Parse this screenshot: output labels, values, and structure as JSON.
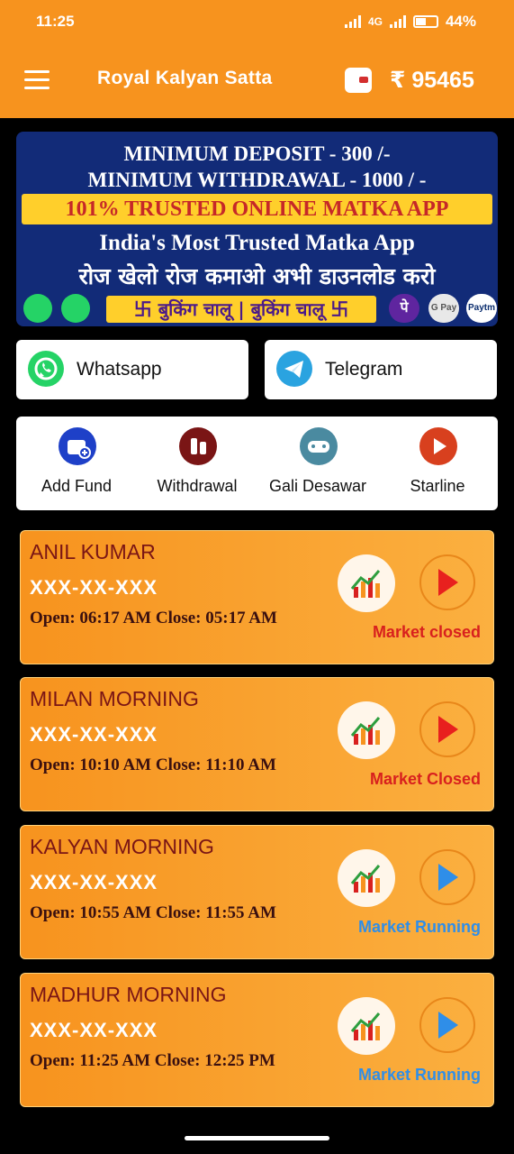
{
  "status_bar": {
    "time": "11:25",
    "network": "4G",
    "battery": "44%"
  },
  "header": {
    "title": "Royal Kalyan Satta",
    "balance": "₹ 95465"
  },
  "banner": {
    "line1": "MINIMUM DEPOSIT - 300 /-",
    "line2": "MINIMUM WITHDRAWAL - 1000 / -",
    "line3": "101% TRUSTED ONLINE MATKA APP",
    "line4": "India's Most Trusted Matka App",
    "line5": "रोज खेलो रोज कमाओ अभी डाउनलोड करो",
    "booking": "卐 बुकिंग चालू | बुकिंग चालू 卐",
    "chip_phonepe": "पे",
    "chip_gpay": "G Pay",
    "chip_paytm": "Paytm"
  },
  "contact_buttons": [
    {
      "label": "Whatsapp",
      "icon": "whatsapp-icon",
      "color": "#25d366"
    },
    {
      "label": "Telegram",
      "icon": "telegram-icon",
      "color": "#2aa3e0"
    }
  ],
  "actions": [
    {
      "label": "Add Fund",
      "icon": "add-fund-icon",
      "color": "#1e40c8"
    },
    {
      "label": "Withdrawal",
      "icon": "withdrawal-icon",
      "color": "#7a1515"
    },
    {
      "label": "Gali Desawar",
      "icon": "gamepad-icon",
      "color": "#4a8aa0"
    },
    {
      "label": "Starline",
      "icon": "play-icon",
      "color": "#d8401e"
    }
  ],
  "markets": [
    {
      "name": "ANIL KUMAR",
      "number": "XXX-XX-XXX",
      "times": "Open: 06:17 AM  Close: 05:17 AM",
      "status": "Market closed",
      "status_color": "#d8201e",
      "play_color": "#e8201e"
    },
    {
      "name": "MILAN MORNING",
      "number": "XXX-XX-XXX",
      "times": "Open: 10:10 AM  Close: 11:10 AM",
      "status": "Market Closed",
      "status_color": "#d8201e",
      "play_color": "#e8201e"
    },
    {
      "name": "KALYAN MORNING",
      "number": "XXX-XX-XXX",
      "times": "Open: 10:55 AM  Close: 11:55 AM",
      "status": "Market Running",
      "status_color": "#2f8ee8",
      "play_color": "#2f8ee8"
    },
    {
      "name": "MADHUR MORNING",
      "number": "XXX-XX-XXX",
      "times": "Open: 11:25 AM  Close: 12:25 PM",
      "status": "Market Running",
      "status_color": "#2f8ee8",
      "play_color": "#2f8ee8"
    }
  ]
}
